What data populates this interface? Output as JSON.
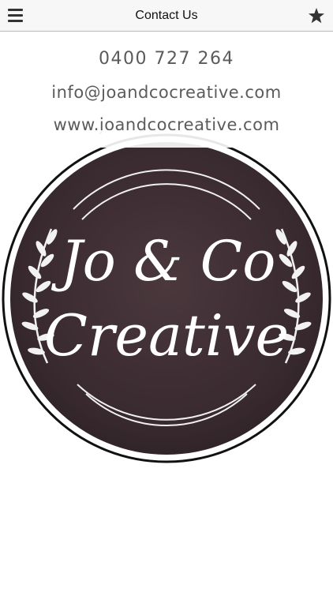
{
  "header": {
    "title": "Contact Us",
    "menu_icon": "hamburger-menu-icon",
    "favorite_icon": "star-icon"
  },
  "contact": {
    "phone": "0400 727 264",
    "email": "info@joandcocreative.com",
    "website": "www.joandcocreative.com"
  },
  "logo": {
    "line1": "Jo & Co",
    "line2": "Creative",
    "background_color": "#3a2b30"
  }
}
